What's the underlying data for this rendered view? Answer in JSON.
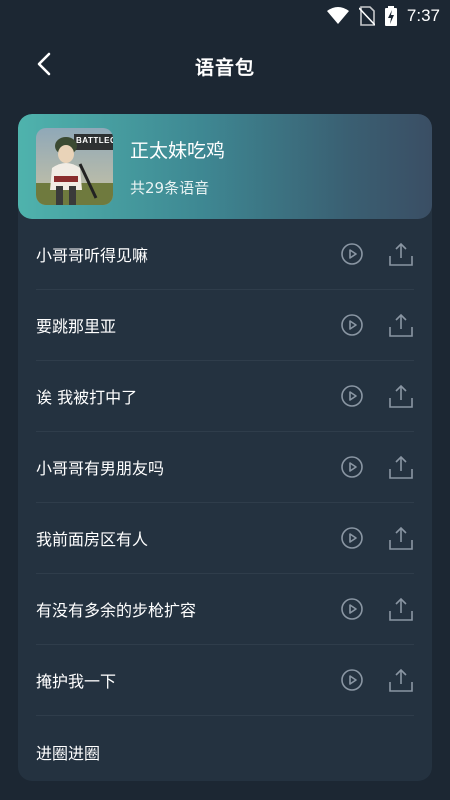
{
  "status_bar": {
    "time": "7:37"
  },
  "header": {
    "title": "语音包"
  },
  "pack": {
    "name": "正太妹吃鸡",
    "count_text": "共29条语音",
    "thumbnail_label": "BATTLEGR"
  },
  "voice_lines": [
    {
      "label": "小哥哥听得见嘛"
    },
    {
      "label": "要跳那里亚"
    },
    {
      "label": "诶 我被打中了"
    },
    {
      "label": "小哥哥有男朋友吗"
    },
    {
      "label": "我前面房区有人"
    },
    {
      "label": "有没有多余的步枪扩容"
    },
    {
      "label": "掩护我一下"
    },
    {
      "label": "进圈进圈"
    }
  ],
  "colors": {
    "background": "#1c2733",
    "card": "#243240",
    "header_gradient_start": "#4fb3ad",
    "header_gradient_end": "#3a4e64",
    "icon": "#8a96a3"
  },
  "icons": {
    "play": "play-circle-icon",
    "share": "share-upload-icon",
    "back": "chevron-left-icon"
  }
}
